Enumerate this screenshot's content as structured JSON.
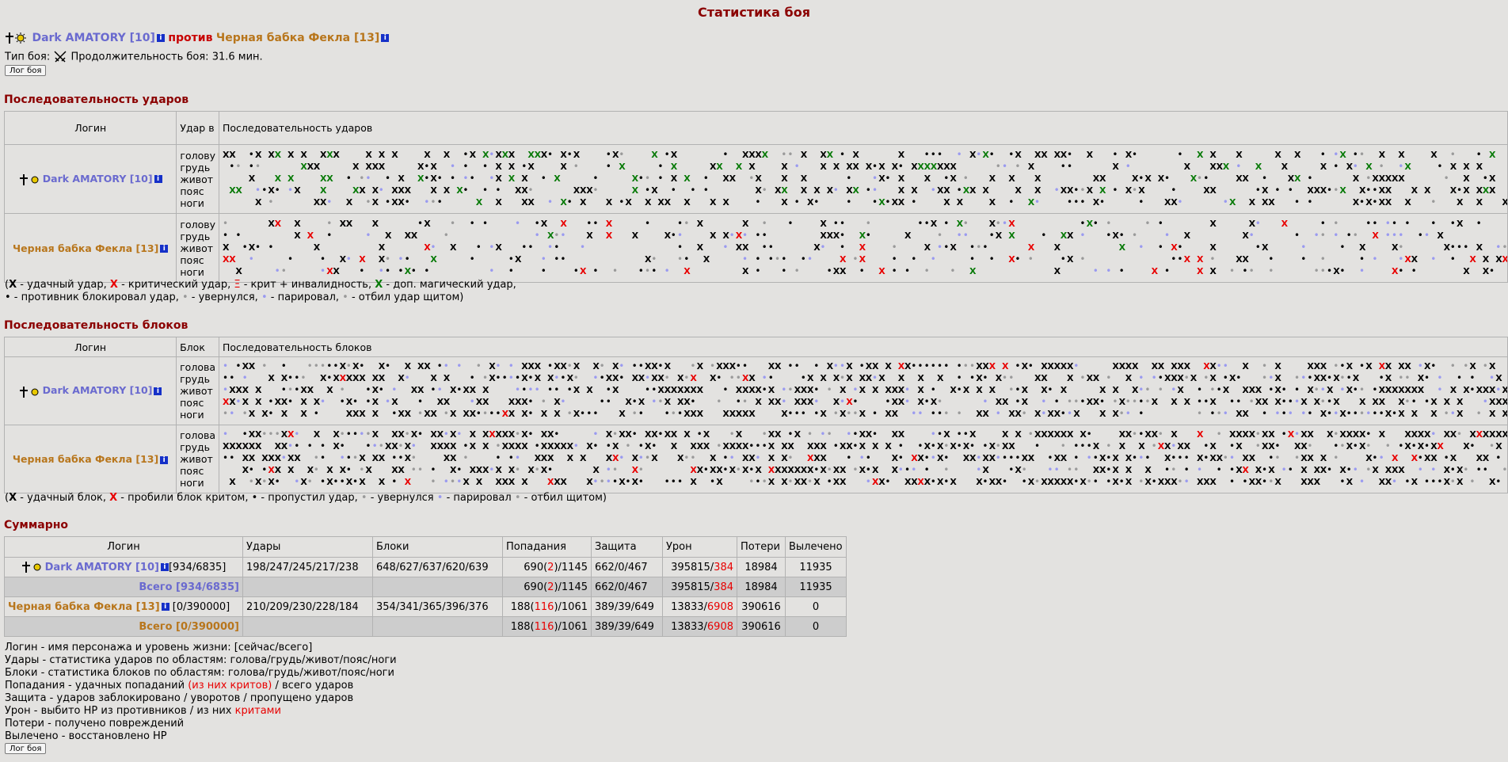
{
  "page": {
    "title": "Статистика боя",
    "log_button": "Лог боя"
  },
  "fighters": {
    "p1": {
      "name": "Dark AMATORY [10]",
      "color": "#6a6acf"
    },
    "vs": "против",
    "p2": {
      "name": "Черная бабка Фекла [13]",
      "color": "#b8761c"
    },
    "info_icon": "i"
  },
  "battle": {
    "type_label": "Тип боя:",
    "duration_label": "Продолжительность боя: 31.6 мин."
  },
  "attacks": {
    "title": "Последовательность ударов",
    "col_login": "Логин",
    "col_zone": "Удар в",
    "col_seq": "Последовательность ударов",
    "zones": [
      "голову",
      "грудь",
      "живот",
      "пояс",
      "ноги"
    ],
    "legend_line1": [
      "X",
      " - удачный удар, ",
      "X",
      " - критический удар, ",
      "Ξ",
      " - крит + инвалидность, ",
      "X",
      " - доп. магический удар,"
    ],
    "legend_line2": [
      "•",
      " - противник блокировал удар, ",
      "•",
      " - увернулся, ",
      "•",
      " - парировал, ",
      "•",
      " - отбил удар щитом)"
    ]
  },
  "blocks": {
    "title": "Последовательность блоков",
    "col_login": "Логин",
    "col_zone": "Блок",
    "col_seq": "Последовательность блоков",
    "zones": [
      "голова",
      "грудь",
      "живот",
      "пояс",
      "ноги"
    ],
    "legend": [
      "X",
      " - удачный блок, ",
      "X",
      " - пробили блок критом, ",
      "•",
      " - пропустил удар, ",
      "•",
      " - увернулся ",
      "•",
      " - парировал ",
      "•",
      " - отбил щитом)"
    ]
  },
  "summary": {
    "title": "Суммарно",
    "headers": [
      "Логин",
      "Удары",
      "Блоки",
      "Попадания",
      "Защита",
      "Урон",
      "Потери",
      "Вылечено"
    ],
    "rows": [
      {
        "name": "Dark AMATORY [10]",
        "hp": "[934/6835]",
        "hits": "198/247/245/217/238",
        "blocks": "648/627/637/620/639",
        "acc_a": "690(",
        "acc_crit": "2",
        "acc_b": ")/1145",
        "defense": "662/0/467",
        "dmg_a": "395815/",
        "dmg_crit": "384",
        "losses": "18984",
        "healed": "11935"
      },
      {
        "total_label": "Всего [934/6835]",
        "acc_a": "690(",
        "acc_crit": "2",
        "acc_b": ")/1145",
        "defense": "662/0/467",
        "dmg_a": "395815/",
        "dmg_crit": "384",
        "losses": "18984",
        "healed": "11935"
      },
      {
        "name": "Черная бабка Фекла [13]",
        "hp": "[0/390000]",
        "hits": "210/209/230/228/184",
        "blocks": "354/341/365/396/376",
        "acc_a": "188(",
        "acc_crit": "116",
        "acc_b": ")/1061",
        "defense": "389/39/649",
        "dmg_a": "13833/",
        "dmg_crit": "6908",
        "losses": "390616",
        "healed": "0"
      },
      {
        "total_label": "Всего [0/390000]",
        "acc_a": "188(",
        "acc_crit": "116",
        "acc_b": ")/1061",
        "defense": "389/39/649",
        "dmg_a": "13833/",
        "dmg_crit": "6908",
        "losses": "390616",
        "healed": "0"
      }
    ]
  },
  "notes": {
    "l1": "Логин - имя персонажа и уровень жизни: [сейчас/всего]",
    "l2": "Удары - статистика ударов по областям: голова/грудь/живот/пояс/ноги",
    "l3": "Блоки - статистика блоков по областям: голова/грудь/живот/пояс/ноги",
    "l4a": "Попадания - удачных попаданий ",
    "l4b": "(из них критов)",
    "l4c": " / всего ударов",
    "l5": "Защита - ударов заблокировано / уворотов / пропущено ударов",
    "l6a": "Урон - выбито HP из противников / из них ",
    "l6b": "критами",
    "l7": "Потери - получено повреждений",
    "l8": "Вылечено - восстановлено HP"
  },
  "colors": {
    "critical": "#e80000",
    "magic": "#087a08",
    "dodge": "#9a9a9a",
    "parry": "#9a9af0",
    "header": "#8b0000"
  }
}
